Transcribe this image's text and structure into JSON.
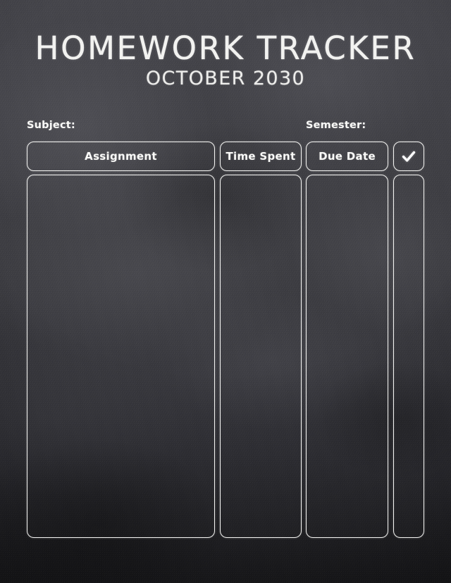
{
  "page": {
    "title": "HOMEWORK TRACKER",
    "subtitle": "OCTOBER 2030",
    "background_color": "#3b3b40",
    "ink_color": "#f4f4f2"
  },
  "fields": [
    {
      "label": "Subject:",
      "value": ""
    },
    {
      "label": "Semester:",
      "value": ""
    }
  ],
  "table": {
    "columns": [
      {
        "key": "assignment",
        "header": "Assignment",
        "icon": null
      },
      {
        "key": "time_spent",
        "header": "Time Spent",
        "icon": null
      },
      {
        "key": "due_date",
        "header": "Due Date",
        "icon": null
      },
      {
        "key": "done",
        "header": "",
        "icon": "checkmark-icon"
      }
    ],
    "rows": []
  }
}
